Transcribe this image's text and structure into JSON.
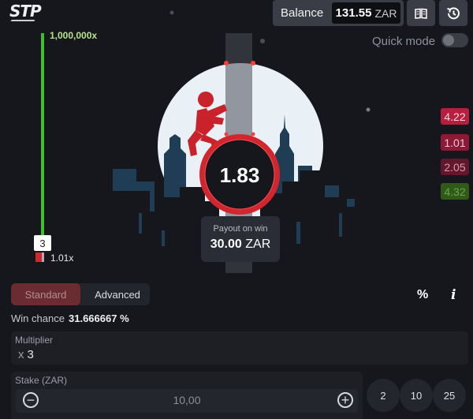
{
  "header": {
    "logo_text": "STP",
    "balance_label": "Balance",
    "balance_value": "131.55",
    "balance_currency": "ZAR",
    "rules_icon": "book-icon",
    "history_icon": "history-icon",
    "quick_mode_label": "Quick mode",
    "quick_mode_on": false
  },
  "ladder": {
    "top_label": "1,000,000x",
    "current_marker": "3",
    "bottom_label": "1.01x"
  },
  "game": {
    "current_multiplier": "1.83",
    "payout_label": "Payout on win",
    "payout_value": "30.00",
    "payout_currency": "ZAR",
    "accent_red": "#d2262f",
    "moon_color": "#e9f0f6"
  },
  "history": [
    {
      "value": "4.22",
      "bg": "#b81e3d",
      "color": "#ffd6de"
    },
    {
      "value": "1.01",
      "bg": "#8c1a34",
      "color": "#f3c5cf"
    },
    {
      "value": "2.05",
      "bg": "#63172d",
      "color": "#d89aa9"
    },
    {
      "value": "4.32",
      "bg": "#2f5a18",
      "color": "#6ea24a"
    }
  ],
  "controls": {
    "tab_standard": "Standard",
    "tab_advanced": "Advanced",
    "percent_icon": "percent-icon",
    "info_icon": "info-icon",
    "win_chance_label": "Win chance",
    "win_chance_value": "31.666667 %",
    "multiplier_label": "Multiplier",
    "multiplier_prefix": "x",
    "multiplier_value": "3",
    "stake_label": "Stake (ZAR)",
    "stake_value": "10,00",
    "minus_icon": "minus-icon",
    "plus_icon": "plus-icon",
    "presets": [
      "2",
      "10",
      "25"
    ]
  }
}
